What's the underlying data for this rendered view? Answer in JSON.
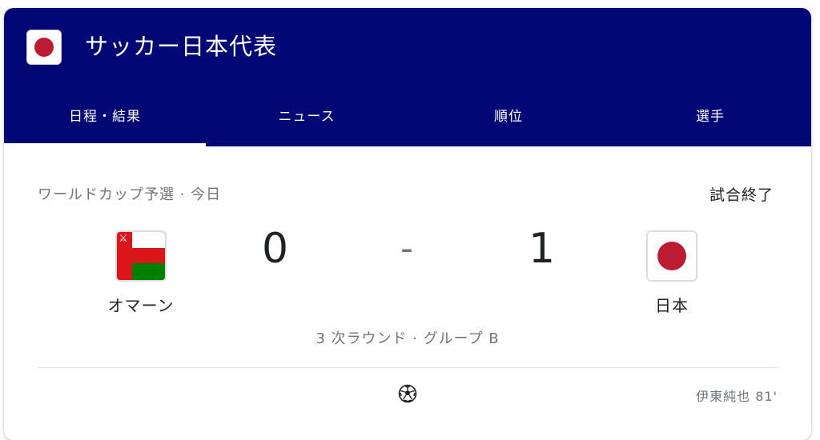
{
  "header": {
    "title": "サッカー日本代表",
    "flag_icon": "japan-flag-icon",
    "background_color": "#020776"
  },
  "tabs": [
    {
      "label": "日程・結果",
      "active": true
    },
    {
      "label": "ニュース",
      "active": false
    },
    {
      "label": "順位",
      "active": false
    },
    {
      "label": "選手",
      "active": false
    }
  ],
  "match": {
    "competition": "ワールドカップ予選 · 今日",
    "status": "試合終了",
    "home": {
      "name": "オマーン",
      "score": "0",
      "flag_icon": "oman-flag-icon"
    },
    "separator": "-",
    "away": {
      "name": "日本",
      "score": "1",
      "flag_icon": "japan-flag-icon"
    },
    "round": "3 次ラウンド · グループ B",
    "goals": [
      {
        "icon": "soccer-ball-icon",
        "scorer": "伊東純也 81'"
      }
    ]
  },
  "colors": {
    "japan_red": "#bc1c33",
    "oman_red": "#db161b",
    "oman_green": "#008000"
  }
}
